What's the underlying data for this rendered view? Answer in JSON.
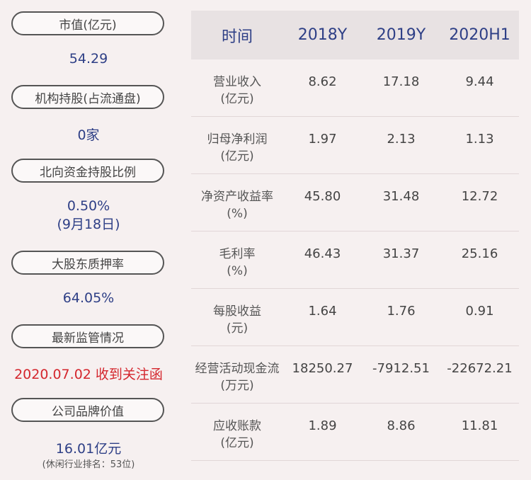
{
  "left_panel": {
    "market_cap": {
      "label": "市值(亿元)",
      "value": "54.29"
    },
    "institutional_holdings": {
      "label": "机构持股(占流通盘)",
      "value": "0家"
    },
    "northbound_ratio": {
      "label": "北向资金持股比例",
      "value": "0.50%",
      "date": "(9月18日)"
    },
    "pledge_rate": {
      "label": "大股东质押率",
      "value": "64.05%"
    },
    "regulation": {
      "label": "最新监管情况",
      "value": "2020.07.02 收到关注函",
      "value_color": "#d4262d"
    },
    "brand_value": {
      "label": "公司品牌价值",
      "value": "16.01亿元",
      "note": "(休闲行业排名：53位)"
    }
  },
  "table": {
    "headers": [
      "时间",
      "2018Y",
      "2019Y",
      "2020H1"
    ],
    "rows": [
      {
        "label1": "营业收入",
        "label2": "(亿元)",
        "values": [
          "8.62",
          "17.18",
          "9.44"
        ]
      },
      {
        "label1": "归母净利润",
        "label2": "(亿元)",
        "values": [
          "1.97",
          "2.13",
          "1.13"
        ]
      },
      {
        "label1": "净资产收益率",
        "label2": "(%)",
        "values": [
          "45.80",
          "31.48",
          "12.72"
        ]
      },
      {
        "label1": "毛利率",
        "label2": "(%)",
        "values": [
          "46.43",
          "31.37",
          "25.16"
        ]
      },
      {
        "label1": "每股收益",
        "label2": "(元)",
        "values": [
          "1.64",
          "1.76",
          "0.91"
        ]
      },
      {
        "label1": "经营活动现金流",
        "label2": "(万元)",
        "values": [
          "18250.27",
          "-7912.51",
          "-22672.21"
        ]
      },
      {
        "label1": "应收账款",
        "label2": "(亿元)",
        "values": [
          "1.89",
          "8.86",
          "11.81"
        ]
      }
    ]
  },
  "colors": {
    "background": "#f6f0f0",
    "header_bg": "#e8e2e3",
    "value_blue": "#2e3f86",
    "alert_red": "#d4262d"
  }
}
